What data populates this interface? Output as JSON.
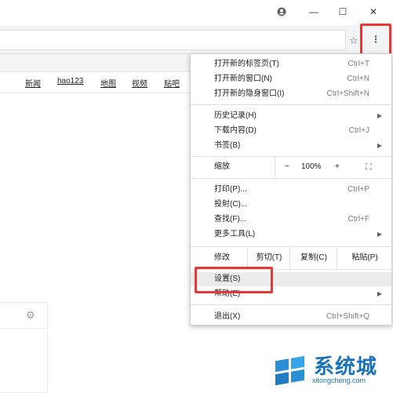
{
  "window": {
    "profile_icon": "account-circle-icon",
    "minimize_label": "—",
    "maximize_label": "☐",
    "close_label": "✕"
  },
  "toolbar": {
    "bookmark_icon": "star-icon",
    "menu_label": "⋮"
  },
  "page": {
    "nav_links": [
      "新闻",
      "hao123",
      "地图",
      "视频",
      "贴吧"
    ]
  },
  "menu": {
    "new_tab": {
      "label": "打开新的标签页(T)",
      "shortcut": "Ctrl+T"
    },
    "new_window": {
      "label": "打开新的窗口(N)",
      "shortcut": "Ctrl+N"
    },
    "incognito": {
      "label": "打开新的隐身窗口(I)",
      "shortcut": "Ctrl+Shift+N"
    },
    "history": {
      "label": "历史记录(H)"
    },
    "downloads": {
      "label": "下载内容(D)",
      "shortcut": "Ctrl+J"
    },
    "bookmarks": {
      "label": "书签(B)"
    },
    "zoom": {
      "label": "缩放",
      "minus": "−",
      "value": "100%",
      "plus": "+",
      "fullscreen": "⛶"
    },
    "print": {
      "label": "打印(P)...",
      "shortcut": "Ctrl+P"
    },
    "cast": {
      "label": "投射(C)..."
    },
    "find": {
      "label": "查找(F)...",
      "shortcut": "Ctrl+F"
    },
    "more_tools": {
      "label": "更多工具(L)"
    },
    "edit": {
      "label": "修改",
      "cut": "剪切(T)",
      "copy": "复制(C)",
      "paste": "粘贴(P)"
    },
    "settings": {
      "label": "设置(S)"
    },
    "help": {
      "label": "帮助(E)"
    },
    "exit": {
      "label": "退出(X)",
      "shortcut": "Ctrl+Shift+Q"
    }
  },
  "watermark": {
    "brand": "系统城",
    "url": "xitongcheng.com"
  },
  "colors": {
    "highlight": "#e53935",
    "watermark": "#1a73b8"
  }
}
